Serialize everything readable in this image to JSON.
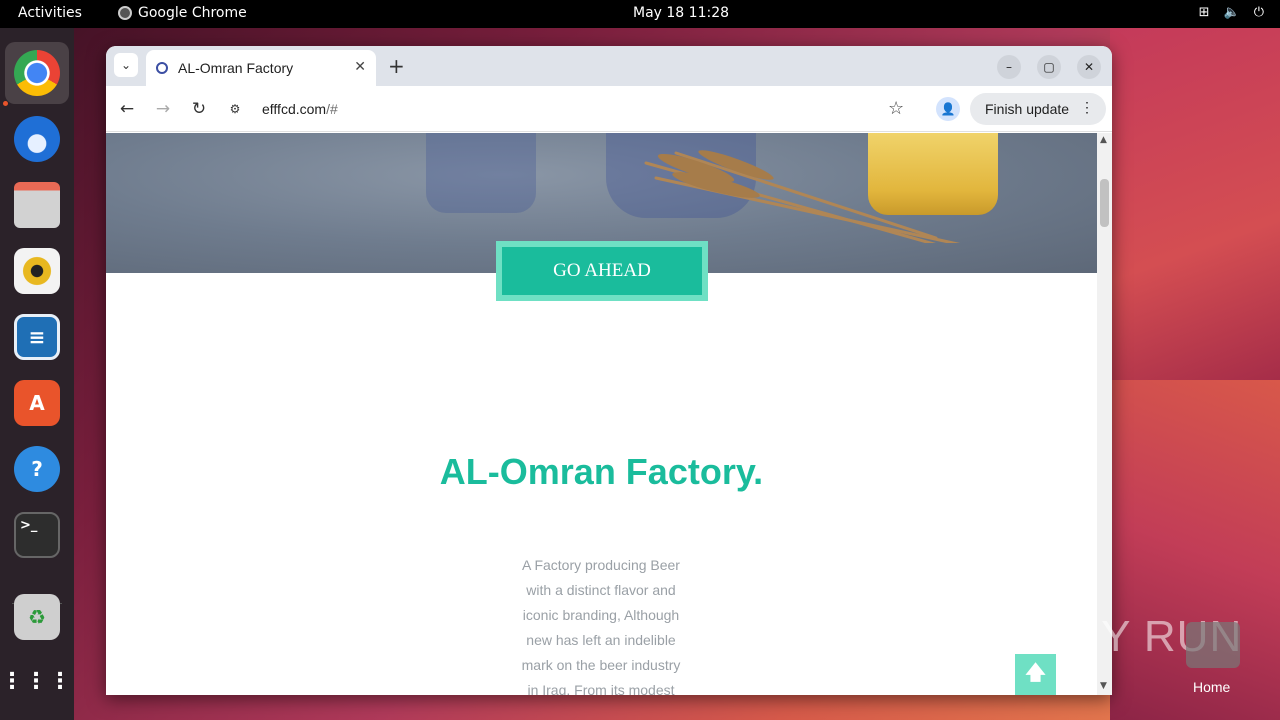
{
  "topbar": {
    "activities": "Activities",
    "app_name": "Google Chrome",
    "clock": "May 18  11:28"
  },
  "dock": {
    "items": [
      {
        "name": "chrome",
        "icon": "chrome-icon"
      },
      {
        "name": "thunderbird",
        "icon": "thunderbird-icon"
      },
      {
        "name": "files",
        "icon": "files-icon"
      },
      {
        "name": "rhythmbox",
        "icon": "rhythmbox-icon"
      },
      {
        "name": "writer",
        "icon": "libreoffice-writer-icon"
      },
      {
        "name": "app-center",
        "icon": "app-center-icon"
      },
      {
        "name": "help",
        "icon": "help-icon"
      },
      {
        "name": "terminal",
        "icon": "terminal-icon"
      },
      {
        "name": "trash",
        "icon": "trash-icon"
      },
      {
        "name": "show-apps",
        "icon": "app-grid-icon"
      }
    ]
  },
  "browser": {
    "tab_title": "AL-Omran Factory",
    "url_domain": "efffcd.com",
    "url_path": "/#",
    "finish_update_label": "Finish update"
  },
  "page": {
    "go_ahead_label": "GO AHEAD",
    "heading": "AL-Omran Factory.",
    "paragraph_lines": [
      "A Factory producing Beer",
      "with a distinct flavor and",
      "iconic branding, Although",
      "new has left an indelible",
      "mark on the beer industry",
      "in Iraq. From its modest"
    ]
  },
  "desktop": {
    "home_label": "Home",
    "watermark": "ANY RUN"
  },
  "colors": {
    "accent": "#1abc9c",
    "accent_light": "#6fe0c4"
  }
}
